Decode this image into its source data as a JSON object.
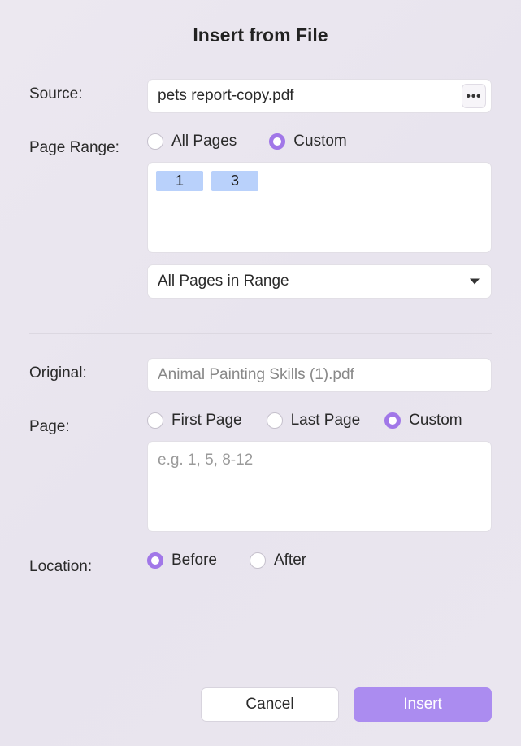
{
  "title": "Insert from File",
  "labels": {
    "source": "Source:",
    "pageRange": "Page Range:",
    "original": "Original:",
    "page": "Page:",
    "location": "Location:"
  },
  "source": {
    "value": "pets report-copy.pdf",
    "moreGlyph": "•••"
  },
  "pageRange": {
    "options": {
      "all": "All Pages",
      "custom": "Custom"
    },
    "selected": "custom",
    "chips": [
      "1",
      "3"
    ],
    "filter": {
      "selected": "All Pages in Range"
    }
  },
  "original": {
    "value": "Animal Painting Skills (1).pdf"
  },
  "page": {
    "options": {
      "first": "First Page",
      "last": "Last Page",
      "custom": "Custom"
    },
    "selected": "custom",
    "placeholder": "e.g. 1, 5, 8-12",
    "value": ""
  },
  "location": {
    "options": {
      "before": "Before",
      "after": "After"
    },
    "selected": "before"
  },
  "buttons": {
    "cancel": "Cancel",
    "insert": "Insert"
  }
}
